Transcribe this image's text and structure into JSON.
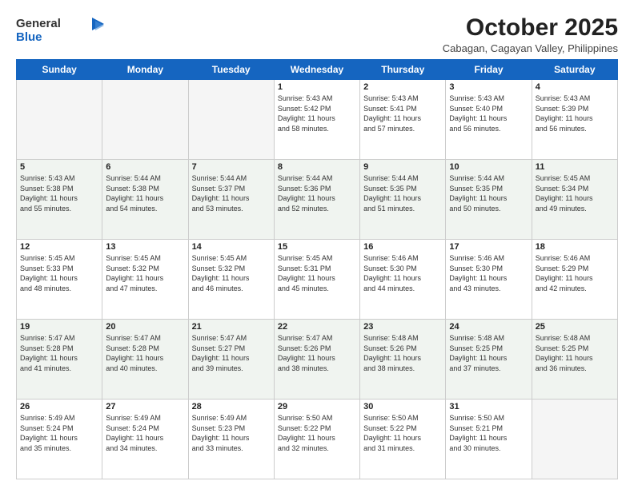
{
  "logo": {
    "general": "General",
    "blue": "Blue"
  },
  "title": "October 2025",
  "subtitle": "Cabagan, Cagayan Valley, Philippines",
  "days_of_week": [
    "Sunday",
    "Monday",
    "Tuesday",
    "Wednesday",
    "Thursday",
    "Friday",
    "Saturday"
  ],
  "weeks": [
    [
      {
        "day": "",
        "info": ""
      },
      {
        "day": "",
        "info": ""
      },
      {
        "day": "",
        "info": ""
      },
      {
        "day": "1",
        "info": "Sunrise: 5:43 AM\nSunset: 5:42 PM\nDaylight: 11 hours\nand 58 minutes."
      },
      {
        "day": "2",
        "info": "Sunrise: 5:43 AM\nSunset: 5:41 PM\nDaylight: 11 hours\nand 57 minutes."
      },
      {
        "day": "3",
        "info": "Sunrise: 5:43 AM\nSunset: 5:40 PM\nDaylight: 11 hours\nand 56 minutes."
      },
      {
        "day": "4",
        "info": "Sunrise: 5:43 AM\nSunset: 5:39 PM\nDaylight: 11 hours\nand 56 minutes."
      }
    ],
    [
      {
        "day": "5",
        "info": "Sunrise: 5:43 AM\nSunset: 5:38 PM\nDaylight: 11 hours\nand 55 minutes."
      },
      {
        "day": "6",
        "info": "Sunrise: 5:44 AM\nSunset: 5:38 PM\nDaylight: 11 hours\nand 54 minutes."
      },
      {
        "day": "7",
        "info": "Sunrise: 5:44 AM\nSunset: 5:37 PM\nDaylight: 11 hours\nand 53 minutes."
      },
      {
        "day": "8",
        "info": "Sunrise: 5:44 AM\nSunset: 5:36 PM\nDaylight: 11 hours\nand 52 minutes."
      },
      {
        "day": "9",
        "info": "Sunrise: 5:44 AM\nSunset: 5:35 PM\nDaylight: 11 hours\nand 51 minutes."
      },
      {
        "day": "10",
        "info": "Sunrise: 5:44 AM\nSunset: 5:35 PM\nDaylight: 11 hours\nand 50 minutes."
      },
      {
        "day": "11",
        "info": "Sunrise: 5:45 AM\nSunset: 5:34 PM\nDaylight: 11 hours\nand 49 minutes."
      }
    ],
    [
      {
        "day": "12",
        "info": "Sunrise: 5:45 AM\nSunset: 5:33 PM\nDaylight: 11 hours\nand 48 minutes."
      },
      {
        "day": "13",
        "info": "Sunrise: 5:45 AM\nSunset: 5:32 PM\nDaylight: 11 hours\nand 47 minutes."
      },
      {
        "day": "14",
        "info": "Sunrise: 5:45 AM\nSunset: 5:32 PM\nDaylight: 11 hours\nand 46 minutes."
      },
      {
        "day": "15",
        "info": "Sunrise: 5:45 AM\nSunset: 5:31 PM\nDaylight: 11 hours\nand 45 minutes."
      },
      {
        "day": "16",
        "info": "Sunrise: 5:46 AM\nSunset: 5:30 PM\nDaylight: 11 hours\nand 44 minutes."
      },
      {
        "day": "17",
        "info": "Sunrise: 5:46 AM\nSunset: 5:30 PM\nDaylight: 11 hours\nand 43 minutes."
      },
      {
        "day": "18",
        "info": "Sunrise: 5:46 AM\nSunset: 5:29 PM\nDaylight: 11 hours\nand 42 minutes."
      }
    ],
    [
      {
        "day": "19",
        "info": "Sunrise: 5:47 AM\nSunset: 5:28 PM\nDaylight: 11 hours\nand 41 minutes."
      },
      {
        "day": "20",
        "info": "Sunrise: 5:47 AM\nSunset: 5:28 PM\nDaylight: 11 hours\nand 40 minutes."
      },
      {
        "day": "21",
        "info": "Sunrise: 5:47 AM\nSunset: 5:27 PM\nDaylight: 11 hours\nand 39 minutes."
      },
      {
        "day": "22",
        "info": "Sunrise: 5:47 AM\nSunset: 5:26 PM\nDaylight: 11 hours\nand 38 minutes."
      },
      {
        "day": "23",
        "info": "Sunrise: 5:48 AM\nSunset: 5:26 PM\nDaylight: 11 hours\nand 38 minutes."
      },
      {
        "day": "24",
        "info": "Sunrise: 5:48 AM\nSunset: 5:25 PM\nDaylight: 11 hours\nand 37 minutes."
      },
      {
        "day": "25",
        "info": "Sunrise: 5:48 AM\nSunset: 5:25 PM\nDaylight: 11 hours\nand 36 minutes."
      }
    ],
    [
      {
        "day": "26",
        "info": "Sunrise: 5:49 AM\nSunset: 5:24 PM\nDaylight: 11 hours\nand 35 minutes."
      },
      {
        "day": "27",
        "info": "Sunrise: 5:49 AM\nSunset: 5:24 PM\nDaylight: 11 hours\nand 34 minutes."
      },
      {
        "day": "28",
        "info": "Sunrise: 5:49 AM\nSunset: 5:23 PM\nDaylight: 11 hours\nand 33 minutes."
      },
      {
        "day": "29",
        "info": "Sunrise: 5:50 AM\nSunset: 5:22 PM\nDaylight: 11 hours\nand 32 minutes."
      },
      {
        "day": "30",
        "info": "Sunrise: 5:50 AM\nSunset: 5:22 PM\nDaylight: 11 hours\nand 31 minutes."
      },
      {
        "day": "31",
        "info": "Sunrise: 5:50 AM\nSunset: 5:21 PM\nDaylight: 11 hours\nand 30 minutes."
      },
      {
        "day": "",
        "info": ""
      }
    ]
  ]
}
